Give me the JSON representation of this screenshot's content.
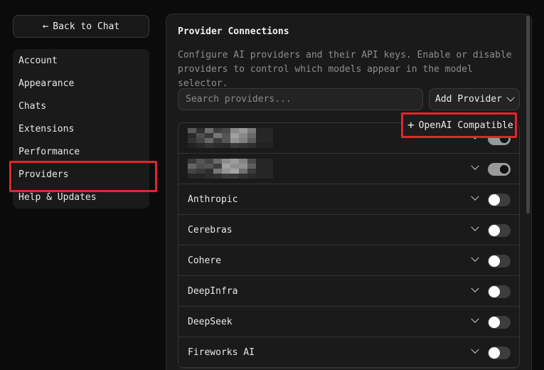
{
  "sidebar": {
    "back_label": "Back to Chat",
    "items": [
      {
        "label": "Account"
      },
      {
        "label": "Appearance"
      },
      {
        "label": "Chats"
      },
      {
        "label": "Extensions"
      },
      {
        "label": "Performance"
      },
      {
        "label": "Providers"
      },
      {
        "label": "Help & Updates"
      }
    ],
    "active": "Providers"
  },
  "main": {
    "title": "Provider Connections",
    "description": "Configure AI providers and their API keys. Enable or disable providers to control which models appear in the model selector.",
    "search_placeholder": "Search providers...",
    "add_provider_label": "Add Provider",
    "dropdown_option": "OpenAI Compatible",
    "providers": [
      {
        "name": "",
        "enabled": true,
        "redacted": true
      },
      {
        "name": "",
        "enabled": true,
        "redacted": true
      },
      {
        "name": "Anthropic",
        "enabled": false
      },
      {
        "name": "Cerebras",
        "enabled": false
      },
      {
        "name": "Cohere",
        "enabled": false
      },
      {
        "name": "DeepInfra",
        "enabled": false
      },
      {
        "name": "DeepSeek",
        "enabled": false
      },
      {
        "name": "Fireworks AI",
        "enabled": false
      }
    ]
  },
  "colors": {
    "highlight": "#e0262e",
    "background": "#0b0b0b",
    "panel": "#1a1a1a"
  },
  "icons": {
    "back": "arrow-left-icon",
    "add": "plus-icon",
    "expand": "chevron-down-icon"
  }
}
